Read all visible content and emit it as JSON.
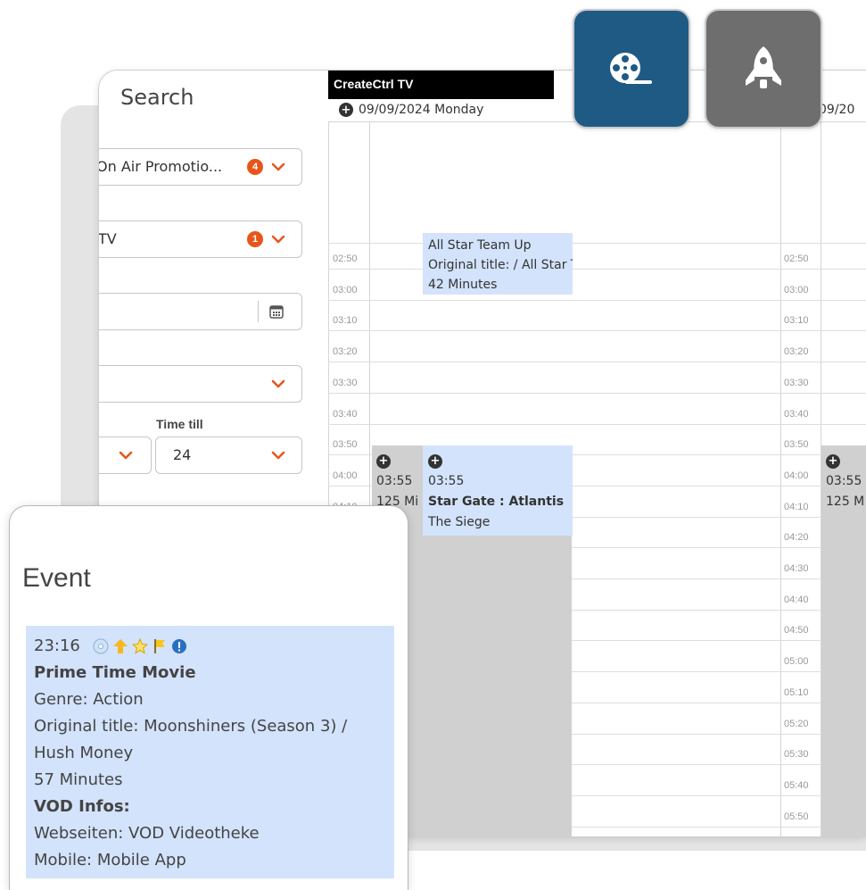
{
  "search": {
    "title": "Search",
    "promotion_value": "On Air Promotio...",
    "promotion_count": "4",
    "channel_value": "TV",
    "channel_count": "1",
    "time_till_label": "Time till",
    "time_till_value": "24"
  },
  "schedule": {
    "channel_name": "CreateCtrl TV",
    "date_primary": "09/09/2024 Monday",
    "date_secondary": "09/20",
    "times": [
      "02:50",
      "03:00",
      "03:10",
      "03:20",
      "03:30",
      "03:40",
      "03:50",
      "04:00",
      "04:10",
      "04:20",
      "04:30",
      "04:40",
      "04:50",
      "05:00",
      "05:10",
      "05:20",
      "05:30",
      "05:40",
      "05:50"
    ],
    "event_top": {
      "line1": "All Star Team Up",
      "line2": "Original title: / All Star T",
      "line3": "42 Minutes"
    },
    "event_gray_left": {
      "time": "03:55",
      "duration": "125 Mi"
    },
    "event_main": {
      "time": "03:55",
      "title": "Star Gate : Atlantis",
      "subtitle": "The Siege"
    },
    "event_gray_right": {
      "time": "03:55",
      "duration": "125 M"
    }
  },
  "tiles": {
    "film_icon": "film-reel-icon",
    "rocket_icon": "rocket-icon",
    "film_color": "#1f5a85",
    "rocket_color": "#6e6e6e"
  },
  "event_panel": {
    "title": "Event",
    "time": "23:16",
    "name": "Prime Time Movie",
    "genre": "Genre: Action",
    "original_title": "Original title: Moonshiners (Season 3) /",
    "original_title_cont": "Hush Money",
    "duration": "57 Minutes",
    "vod_heading": "VOD Infos:",
    "web": "Webseiten: VOD Videotheke",
    "mobile": "Mobile: Mobile App"
  },
  "colors": {
    "accent_orange": "#e8551a",
    "event_blue": "#d3e3fb",
    "block_gray": "#d0d0d0"
  }
}
